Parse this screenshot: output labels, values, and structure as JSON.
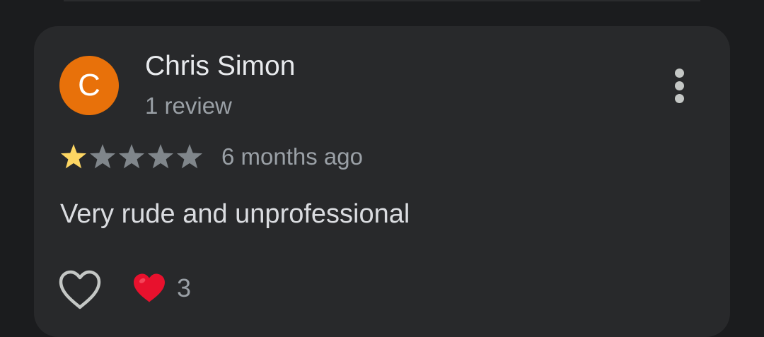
{
  "review": {
    "author_initial": "C",
    "author_name": "Chris Simon",
    "author_reviews": "1 review",
    "rating": 1,
    "rating_max": 5,
    "time": "6 months ago",
    "text": "Very rude and unprofessional",
    "reaction_count": "3"
  },
  "colors": {
    "avatar": "#e8710a",
    "star_filled": "#fdd663",
    "star_empty": "#80868b",
    "heart_filled": "#e8112d"
  },
  "icons": {
    "more": "more-vert-icon",
    "like": "heart-outline-icon",
    "reaction": "heart-filled-icon"
  }
}
